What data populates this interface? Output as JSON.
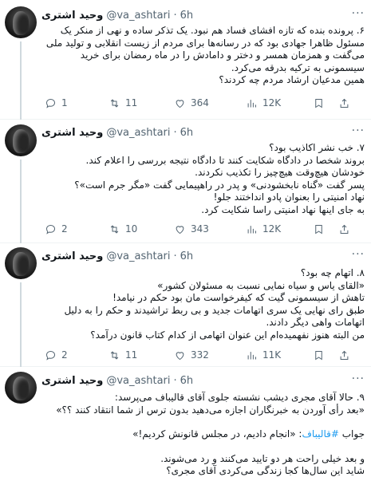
{
  "author": {
    "name": "وحید اشتری",
    "handle": "@va_ashtari",
    "separator": "·"
  },
  "tweets": [
    {
      "time": "6h",
      "text": "۶. پرونده بنده که تازه افشای فساد هم نبود. یک تذکر ساده و نهی از منکر یک مسئول ظاهرا جهادی بود که در رسانه‌ها برای مردم از زیست انقلابی و تولید ملی می‌گفت و همزمان همسر و دختر و دامادش را در ماه رمضان برای خرید سیسمونی به ترکیه بدرقه می‌کرد.\nهمین مدعیان ارشاد مردم چه کردند؟",
      "replies": "1",
      "retweets": "11",
      "likes": "364",
      "views": "12K"
    },
    {
      "time": "6h",
      "text": "۷. خب نشر اکاذیب بود؟\nبروند شخصا در دادگاه شکایت کنند تا دادگاه نتیجه بررسی را اعلام کند.\nخودشان هیچ‌وقت هیچ‌چیز را تکذیب نکردند.\nپسر گفت «گناه نابخشودنی» و پدر در راهپیمایی گفت «مگر جرم است»؟\nنهاد امنیتی را بعنوان پادو انداختند جلو!\nبه جای اینها نهاد امنیتی راسا شکایت کرد.",
      "replies": "2",
      "retweets": "10",
      "likes": "343",
      "views": "12K"
    },
    {
      "time": "6h",
      "text": "۸. اتهام چه بود؟\n«القای یاس و سیاه نمایی نسبت به مسئولان کشور»\nتاهش از سیسمونی گیت که کیفرخواست مان بود حکم در نیامد!\nطبق رای نهایی یک سری اتهامات جدید و بی ربط تراشیدند و حکم را به دلیل اتهامات واهی دیگر دادند.\nمن البته هنوز نفهمیده‌ام این عنوان اتهامی از کدام کتاب قانون درآمد؟",
      "replies": "2",
      "retweets": "11",
      "likes": "332",
      "views": "11K"
    },
    {
      "time": "6h",
      "text_line1": "۹. حالا آقای مجری دیشب نشسته جلوی آقای قالیباف می‌پرسد:",
      "text_line2": "«بعد رأی آوردن به خبرنگاران اجازه می‌دهید بدون ترس از شما انتقاد کنند ؟؟»",
      "answer_prefix": "جواب",
      "hashtag": "#قالیباف",
      "answer_quote": ": «انجام دادیم، در مجلس قانونش کردیم!»",
      "text_line4": "و بعد خیلی راحت هر دو تایید می‌کنند و رد می‌شوند.",
      "text_line5": "شاید این سال‌ها کجا زندگی می‌کردی آقای مجری؟"
    }
  ]
}
